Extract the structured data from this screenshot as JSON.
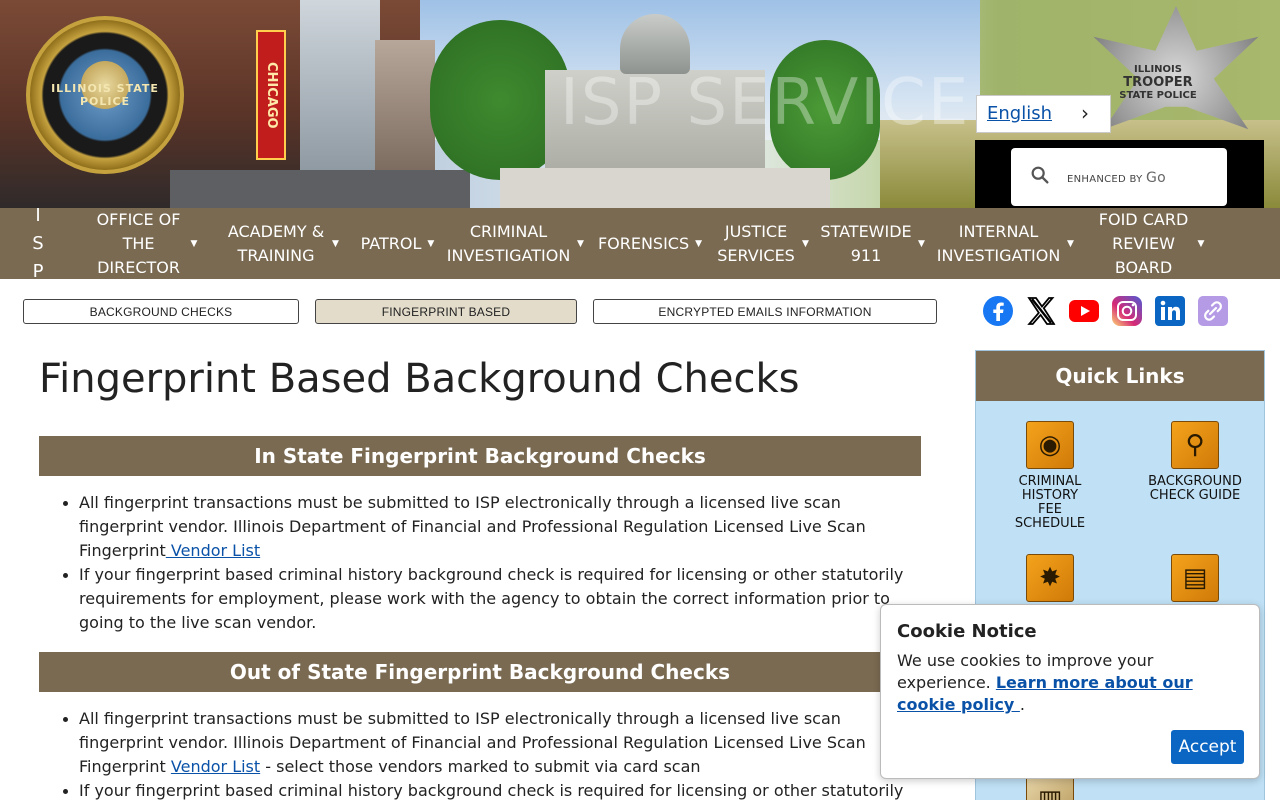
{
  "header": {
    "seal_text": "ILLINOIS STATE POLICE",
    "chicago_sign": "CHICAGO",
    "badge_line1": "ILLINOIS",
    "badge_line2": "TROOPER",
    "badge_line3": "STATE POLICE",
    "language": "English",
    "search_enhanced": "ENHANCED BY",
    "search_brand": "Go"
  },
  "nav": {
    "items": [
      {
        "label": "I S P"
      },
      {
        "label": "OFFICE OF THE DIRECTOR"
      },
      {
        "label": "ACADEMY & TRAINING"
      },
      {
        "label": "PATROL"
      },
      {
        "label": "CRIMINAL INVESTIGATION"
      },
      {
        "label": "FORENSICS"
      },
      {
        "label": "JUSTICE SERVICES"
      },
      {
        "label": "STATEWIDE 911"
      },
      {
        "label": "INTERNAL INVESTIGATION"
      },
      {
        "label": "FOID CARD REVIEW BOARD"
      }
    ]
  },
  "subnav": {
    "background_checks": "BACKGROUND CHECKS",
    "fingerprint_based": "FINGERPRINT BASED",
    "encrypted_emails": "ENCRYPTED EMAILS INFORMATION"
  },
  "social": {
    "colors": {
      "facebook": "#1877f2",
      "x": "#000000",
      "youtube": "#ff0000",
      "instagram": "#d62976",
      "linkedin": "#0a66c2",
      "link": "#b59be6"
    }
  },
  "main": {
    "title": "Fingerprint Based Background Checks",
    "in_state": {
      "heading": "In State Fingerprint Background Checks",
      "b1_text": "All fingerprint transactions must be submitted to ISP electronically through a licensed live scan fingerprint vendor. Illinois Department of Financial and Professional Regulation Licensed Live Scan Fingerprint",
      "b1_link": " Vendor List",
      "b2_text": "If your fingerprint based criminal history background check is required for licensing or other statutorily requirements for employment, please work with the agency to obtain the correct information prior to going to the live scan vendor."
    },
    "out_state": {
      "heading": "Out of State Fingerprint Background Checks",
      "b1_text": "All fingerprint transactions must be submitted to ISP electronically through a licensed live scan fingerprint vendor. Illinois Department of Financial and Professional Regulation Licensed Live Scan Fingerprint ",
      "b1_link": "Vendor List",
      "b1_after": " - select those vendors marked to submit via card scan",
      "b2_text": "If your fingerprint based criminal history background check is required for licensing or other statutorily"
    }
  },
  "quick_links": {
    "title": "Quick Links",
    "item1": "CRIMINAL HISTORY FEE SCHEDULE",
    "item2": "BACKGROUND CHECK GUIDE"
  },
  "cookie": {
    "title": "Cookie Notice",
    "text": "We use cookies to improve your experience. ",
    "link": "Learn more about our cookie policy ",
    "after": ".",
    "accept": "Accept"
  },
  "colors": {
    "brand_brown": "#7a6a52",
    "link_blue": "#0a52a8",
    "accept_blue": "#0a66c2",
    "quick_links_bg": "#bfe0f5"
  }
}
